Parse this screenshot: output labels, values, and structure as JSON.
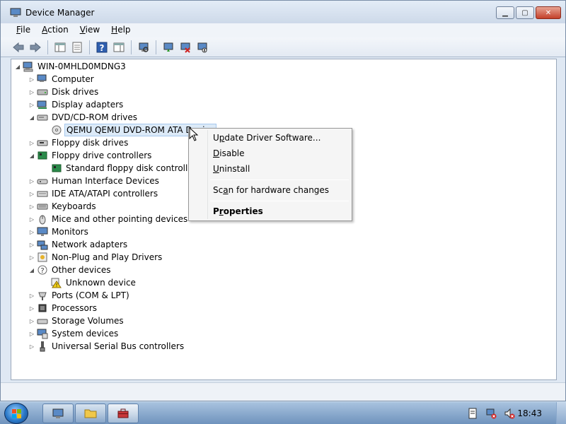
{
  "window": {
    "title": "Device Manager"
  },
  "menubar": {
    "items": [
      {
        "label": "File",
        "accel": "F",
        "rest": "ile"
      },
      {
        "label": "Action",
        "accel": "A",
        "rest": "ction"
      },
      {
        "label": "View",
        "accel": "V",
        "rest": "iew"
      },
      {
        "label": "Help",
        "accel": "H",
        "rest": "elp"
      }
    ]
  },
  "toolbar": {
    "icons": [
      "back-icon",
      "forward-icon",
      "show-hide-console-tree-icon",
      "properties-icon",
      "help-icon",
      "show-action-pane-icon",
      "scan-hardware-icon",
      "update-driver-icon",
      "uninstall-icon",
      "disable-icon"
    ]
  },
  "tree": {
    "root": "WIN-0MHLD0MDNG3",
    "items": [
      {
        "label": "Computer",
        "icon": "computer-icon",
        "expander": "▷",
        "level": 1
      },
      {
        "label": "Disk drives",
        "icon": "disk-drive-icon",
        "expander": "▷",
        "level": 1
      },
      {
        "label": "Display adapters",
        "icon": "display-adapter-icon",
        "expander": "▷",
        "level": 1
      },
      {
        "label": "DVD/CD-ROM drives",
        "icon": "dvd-drive-icon",
        "expander": "◢",
        "level": 1
      },
      {
        "label": "QEMU QEMU DVD-ROM ATA Device",
        "icon": "dvd-device-icon",
        "expander": "",
        "level": 2,
        "selected": true
      },
      {
        "label": "Floppy disk drives",
        "icon": "floppy-drive-icon",
        "expander": "▷",
        "level": 1
      },
      {
        "label": "Floppy drive controllers",
        "icon": "floppy-controller-icon",
        "expander": "◢",
        "level": 1
      },
      {
        "label": "Standard floppy disk controller",
        "icon": "floppy-controller-icon",
        "expander": "",
        "level": 2
      },
      {
        "label": "Human Interface Devices",
        "icon": "hid-icon",
        "expander": "▷",
        "level": 1
      },
      {
        "label": "IDE ATA/ATAPI controllers",
        "icon": "ide-controller-icon",
        "expander": "▷",
        "level": 1
      },
      {
        "label": "Keyboards",
        "icon": "keyboard-icon",
        "expander": "▷",
        "level": 1
      },
      {
        "label": "Mice and other pointing devices",
        "icon": "mouse-icon",
        "expander": "▷",
        "level": 1
      },
      {
        "label": "Monitors",
        "icon": "monitor-icon",
        "expander": "▷",
        "level": 1
      },
      {
        "label": "Network adapters",
        "icon": "network-adapter-icon",
        "expander": "▷",
        "level": 1
      },
      {
        "label": "Non-Plug and Play Drivers",
        "icon": "non-pnp-driver-icon",
        "expander": "▷",
        "level": 1
      },
      {
        "label": "Other devices",
        "icon": "other-devices-icon",
        "expander": "◢",
        "level": 1
      },
      {
        "label": "Unknown device",
        "icon": "unknown-device-warning-icon",
        "expander": "",
        "level": 2
      },
      {
        "label": "Ports (COM & LPT)",
        "icon": "port-icon",
        "expander": "▷",
        "level": 1
      },
      {
        "label": "Processors",
        "icon": "processor-icon",
        "expander": "▷",
        "level": 1
      },
      {
        "label": "Storage Volumes",
        "icon": "storage-volume-icon",
        "expander": "▷",
        "level": 1
      },
      {
        "label": "System devices",
        "icon": "system-device-icon",
        "expander": "▷",
        "level": 1
      },
      {
        "label": "Universal Serial Bus controllers",
        "icon": "usb-controller-icon",
        "expander": "▷",
        "level": 1
      }
    ]
  },
  "context_menu": {
    "update_driver": {
      "accel": "p",
      "pre": "U",
      "post": "date Driver Software..."
    },
    "disable": {
      "accel": "D",
      "pre": "",
      "post": "isable"
    },
    "uninstall": {
      "accel": "U",
      "pre": "",
      "post": "ninstall"
    },
    "scan": {
      "accel": "a",
      "pre": "Sc",
      "post": "n for hardware changes"
    },
    "properties": {
      "accel": "r",
      "pre": "P",
      "post": "operties"
    }
  },
  "taskbar": {
    "clock": "18:43"
  }
}
